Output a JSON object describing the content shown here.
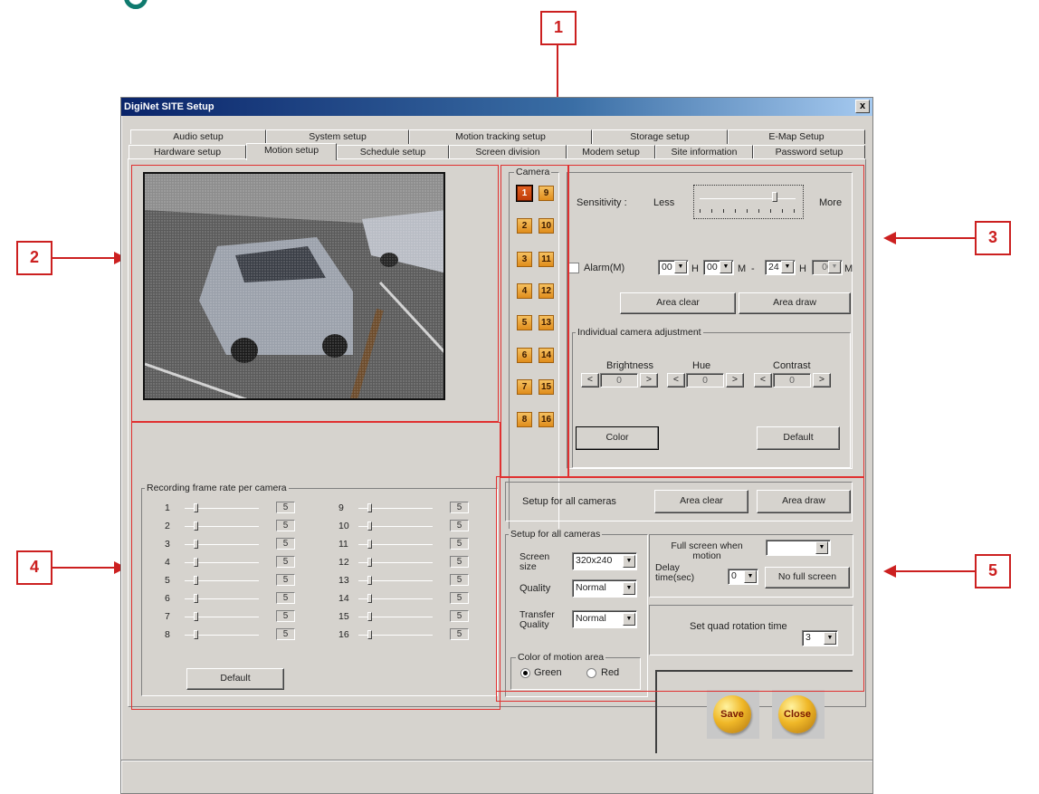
{
  "window": {
    "title": "DigiNet SITE Setup",
    "close": "x"
  },
  "tabs_back": [
    "Audio setup",
    "System setup",
    "Motion tracking setup",
    "Storage setup",
    "E-Map Setup"
  ],
  "tabs_front": [
    "Hardware setup",
    "Motion setup",
    "Schedule setup",
    "Screen division",
    "Modem setup",
    "Site information",
    "Password setup"
  ],
  "camera": {
    "label": "Camera",
    "buttons": [
      "1",
      "9",
      "2",
      "10",
      "3",
      "11",
      "4",
      "12",
      "5",
      "13",
      "6",
      "14",
      "7",
      "15",
      "8",
      "16"
    ],
    "selected": "1"
  },
  "sensitivity": {
    "label": "Sensitivity :",
    "less": "Less",
    "more": "More",
    "level": 0.8
  },
  "alarm": {
    "label": "Alarm(M)",
    "from_h": "00",
    "h1": "H",
    "from_m": "00",
    "m1": "M",
    "dash": "-",
    "to_h": "24",
    "h2": "H",
    "to_m": "00",
    "m2": "M"
  },
  "area_clear": "Area clear",
  "area_draw": "Area draw",
  "adjust": {
    "label": "Individual camera adjustment",
    "brightness": "Brightness",
    "hue": "Hue",
    "contrast": "Contrast",
    "b_val": "0",
    "h_val": "0",
    "c_val": "0",
    "left": "<",
    "right": ">"
  },
  "color_btn": "Color",
  "default_btn": "Default",
  "recording": {
    "label": "Recording frame rate per camera",
    "rows": [
      {
        "n": "1",
        "v": "5"
      },
      {
        "n": "2",
        "v": "5"
      },
      {
        "n": "3",
        "v": "5"
      },
      {
        "n": "4",
        "v": "5"
      },
      {
        "n": "5",
        "v": "5"
      },
      {
        "n": "6",
        "v": "5"
      },
      {
        "n": "7",
        "v": "5"
      },
      {
        "n": "8",
        "v": "5"
      },
      {
        "n": "9",
        "v": "5"
      },
      {
        "n": "10",
        "v": "5"
      },
      {
        "n": "11",
        "v": "5"
      },
      {
        "n": "12",
        "v": "5"
      },
      {
        "n": "13",
        "v": "5"
      },
      {
        "n": "14",
        "v": "5"
      },
      {
        "n": "15",
        "v": "5"
      },
      {
        "n": "16",
        "v": "5"
      }
    ],
    "default_btn": "Default"
  },
  "all_cams_top": {
    "label": "Setup for all cameras",
    "area_clear": "Area clear",
    "area_draw": "Area draw"
  },
  "all_cams": {
    "label": "Setup for all cameras",
    "screen_size_label": "Screen size",
    "screen_size": "320x240",
    "quality_label": "Quality",
    "quality": "Normal",
    "transfer_label": "Transfer Quality",
    "transfer": "Normal",
    "color_label": "Color of motion area",
    "green": "Green",
    "red": "Red",
    "selected": "Green"
  },
  "fullscreen": {
    "label": "Full screen when motion",
    "value": "",
    "delay_label": "Delay time(sec)",
    "delay": "0",
    "no_full": "No full screen"
  },
  "quad": {
    "label": "Set quad rotation time",
    "value": "3"
  },
  "save": "Save",
  "close": "Close",
  "callouts": [
    "1",
    "2",
    "3",
    "4",
    "5"
  ]
}
